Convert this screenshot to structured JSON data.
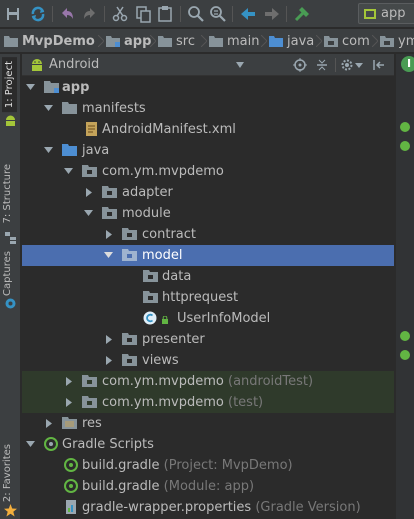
{
  "run_config": {
    "label": "app"
  },
  "breadcrumb": [
    {
      "label": "MvpDemo",
      "bold": true
    },
    {
      "label": "app",
      "bold": true
    },
    {
      "label": "src"
    },
    {
      "label": "main"
    },
    {
      "label": "java"
    },
    {
      "label": "com"
    },
    {
      "label": "ym"
    }
  ],
  "side_tabs": {
    "project": "1: Project",
    "structure": "7: Structure",
    "captures": "Captures",
    "favorites": "2: Favorites"
  },
  "project_view": {
    "title": "Android"
  },
  "right_tab": {
    "label": "I"
  },
  "tree": {
    "app": "app",
    "manifests": "manifests",
    "android_manifest": "AndroidManifest.xml",
    "java": "java",
    "pkg_main": "com.ym.mvpdemo",
    "adapter": "adapter",
    "module": "module",
    "contract": "contract",
    "model": "model",
    "data": "data",
    "httprequest": "httprequest",
    "user_info_model": "UserInfoModel",
    "presenter": "presenter",
    "views": "views",
    "pkg_android_test": "com.ym.mvpdemo",
    "pkg_android_test_hint": "(androidTest)",
    "pkg_test": "com.ym.mvpdemo",
    "pkg_test_hint": "(test)",
    "res": "res",
    "gradle_scripts": "Gradle Scripts",
    "build_gradle_project": "build.gradle",
    "build_gradle_project_hint": "(Project: MvpDemo)",
    "build_gradle_module": "build.gradle",
    "build_gradle_module_hint": "(Module: app)",
    "gradle_wrapper": "gradle-wrapper.properties",
    "gradle_wrapper_hint": "(Gradle Version)"
  },
  "colors": {
    "background": "#2b2b2b",
    "panel": "#3c3f41",
    "selection": "#4b6eaf",
    "test_row": "#2f3a2b",
    "folder": "#87939a",
    "android_green": "#a4c639"
  }
}
